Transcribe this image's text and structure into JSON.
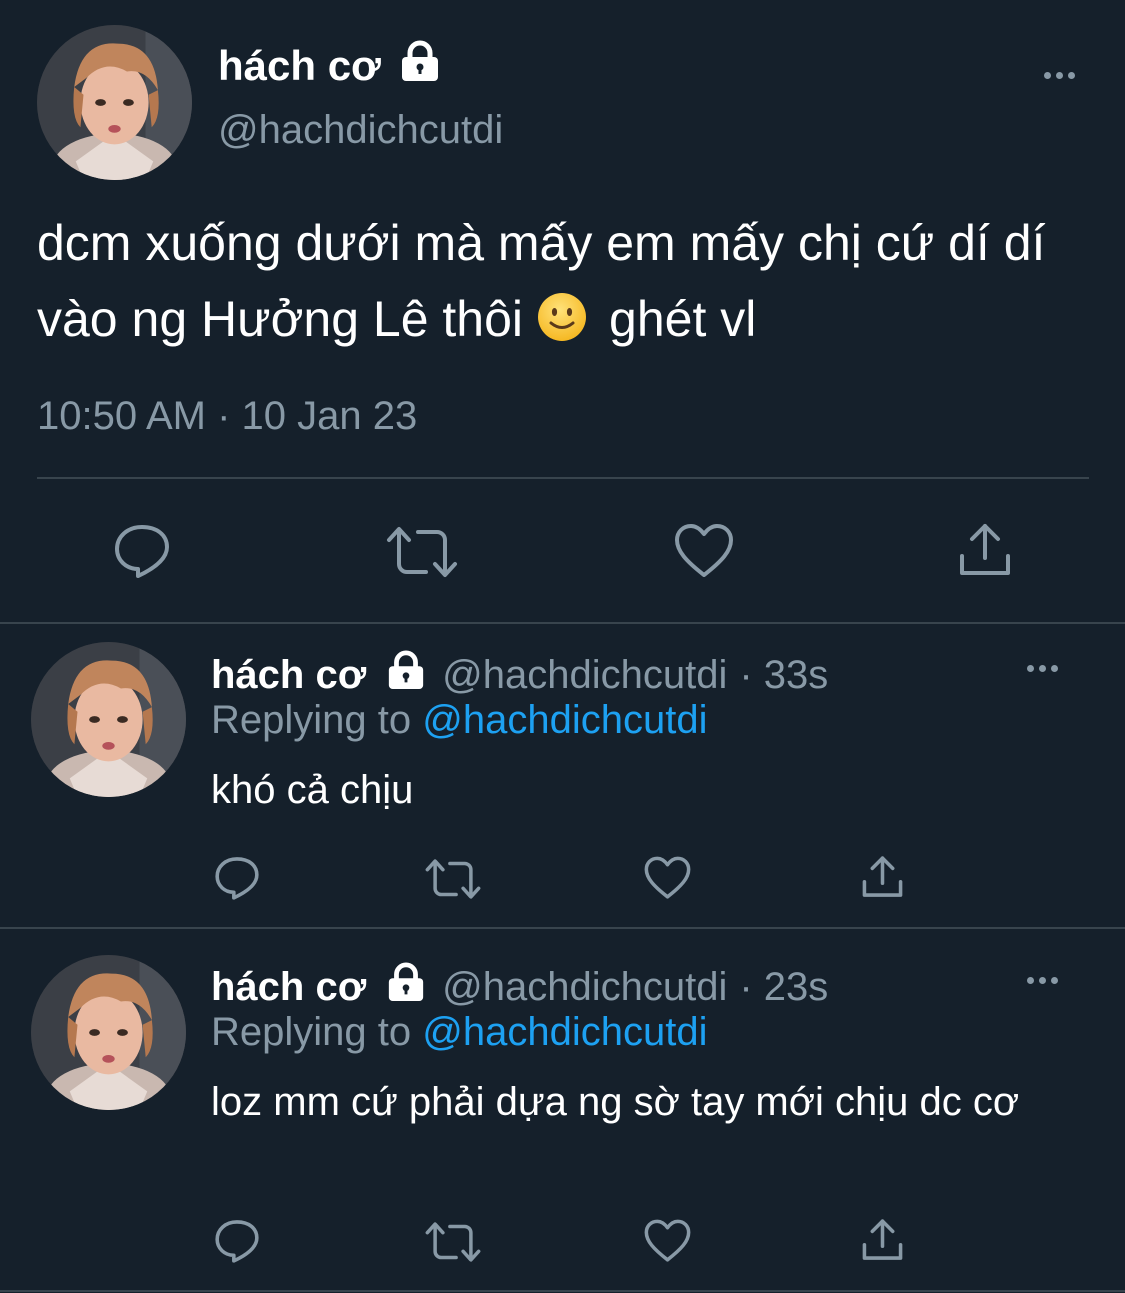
{
  "main_tweet": {
    "display_name": "hách cơ",
    "handle": "@hachdichcutdi",
    "text_before_emoji": "dcm xuống dưới mà mấy em mấy chị cứ dí dí vào ng Hưởng Lê thôi",
    "emoji": "slightly-smiling-face",
    "text_after_emoji": "ghét vl",
    "timestamp": "10:50 AM · 10 Jan 23"
  },
  "replies": [
    {
      "display_name": "hách cơ",
      "handle": "@hachdichcutdi",
      "time": "· 33s",
      "replying_prefix": "Replying to",
      "replying_to": "@hachdichcutdi",
      "text": "khó cả chịu"
    },
    {
      "display_name": "hách cơ",
      "handle": "@hachdichcutdi",
      "time": "· 23s",
      "replying_prefix": "Replying to",
      "replying_to": "@hachdichcutdi",
      "text": "loz mm cứ phải dựa ng sờ tay mới chịu dc cơ"
    }
  ],
  "icons": {
    "reply": "reply-icon",
    "retweet": "retweet-icon",
    "like": "heart-icon",
    "share": "share-icon",
    "more": "more-icon",
    "lock": "lock-icon"
  },
  "colors": {
    "background": "#15202b",
    "secondary_text": "#8899a6",
    "link": "#1da1f2",
    "divider": "#38444d"
  }
}
